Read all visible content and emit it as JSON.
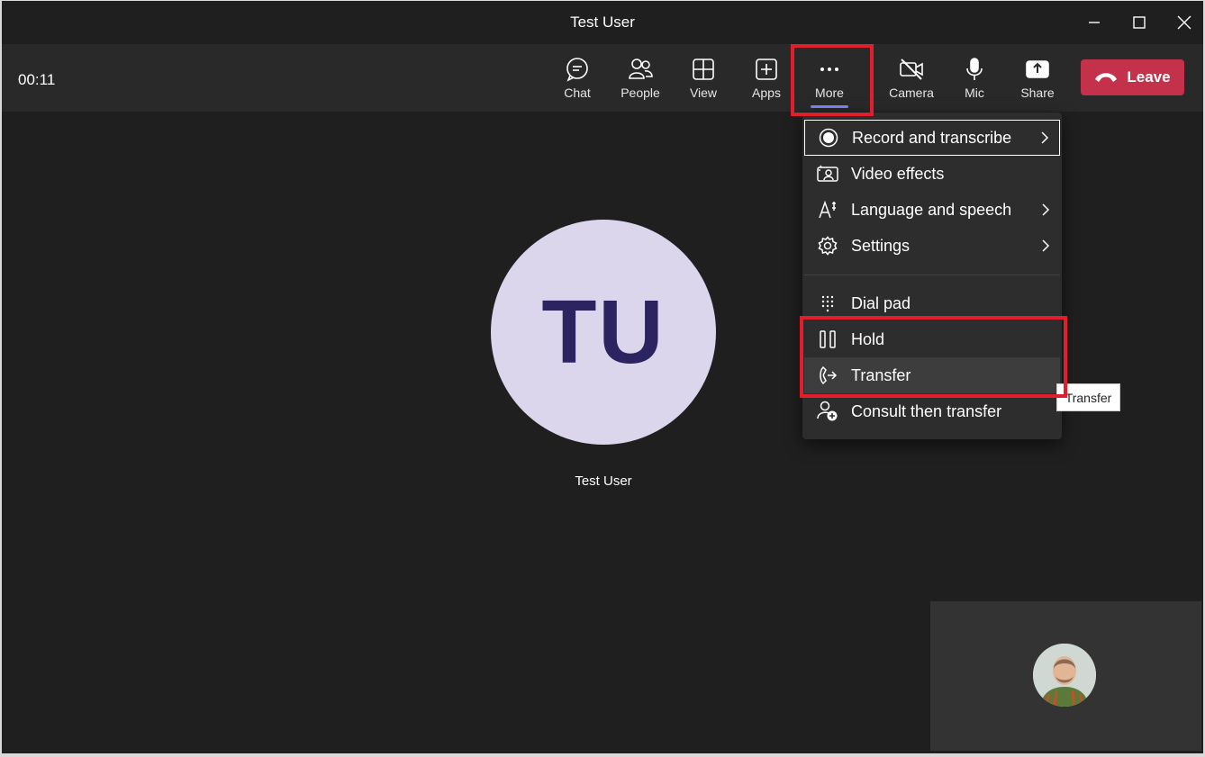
{
  "window": {
    "title": "Test User",
    "controls": [
      "minimize",
      "maximize",
      "close"
    ]
  },
  "callbar": {
    "timer": "00:11",
    "buttons": [
      {
        "label": "Chat",
        "icon": "chat-icon"
      },
      {
        "label": "People",
        "icon": "people-icon"
      },
      {
        "label": "View",
        "icon": "view-grid-icon"
      },
      {
        "label": "Apps",
        "icon": "apps-plus-icon"
      },
      {
        "label": "More",
        "icon": "more-dots-icon",
        "active": true
      },
      {
        "label": "Camera",
        "icon": "camera-off-icon"
      },
      {
        "label": "Mic",
        "icon": "mic-icon"
      },
      {
        "label": "Share",
        "icon": "share-icon"
      }
    ],
    "leave": {
      "label": "Leave",
      "icon": "phone-hangup-icon",
      "color": "#c4314b"
    }
  },
  "stage": {
    "participant_initials": "TU",
    "participant_name": "Test User"
  },
  "more_menu": {
    "items": [
      {
        "label": "Record and transcribe",
        "icon": "record-icon",
        "submenu": true
      },
      {
        "label": "Video effects",
        "icon": "video-effects-icon",
        "submenu": false
      },
      {
        "label": "Language and speech",
        "icon": "language-icon",
        "submenu": true
      },
      {
        "label": "Settings",
        "icon": "gear-icon",
        "submenu": true
      },
      {
        "label": "Dial pad",
        "icon": "dialpad-icon",
        "submenu": false
      },
      {
        "label": "Hold",
        "icon": "pause-icon",
        "submenu": false
      },
      {
        "label": "Transfer",
        "icon": "transfer-icon",
        "submenu": false
      },
      {
        "label": "Consult then transfer",
        "icon": "consult-transfer-icon",
        "submenu": false
      }
    ]
  },
  "tooltip": {
    "text": "Transfer"
  },
  "colors": {
    "accent": "#7f85f5",
    "leave": "#c4314b",
    "highlight": "#e11e2c"
  }
}
